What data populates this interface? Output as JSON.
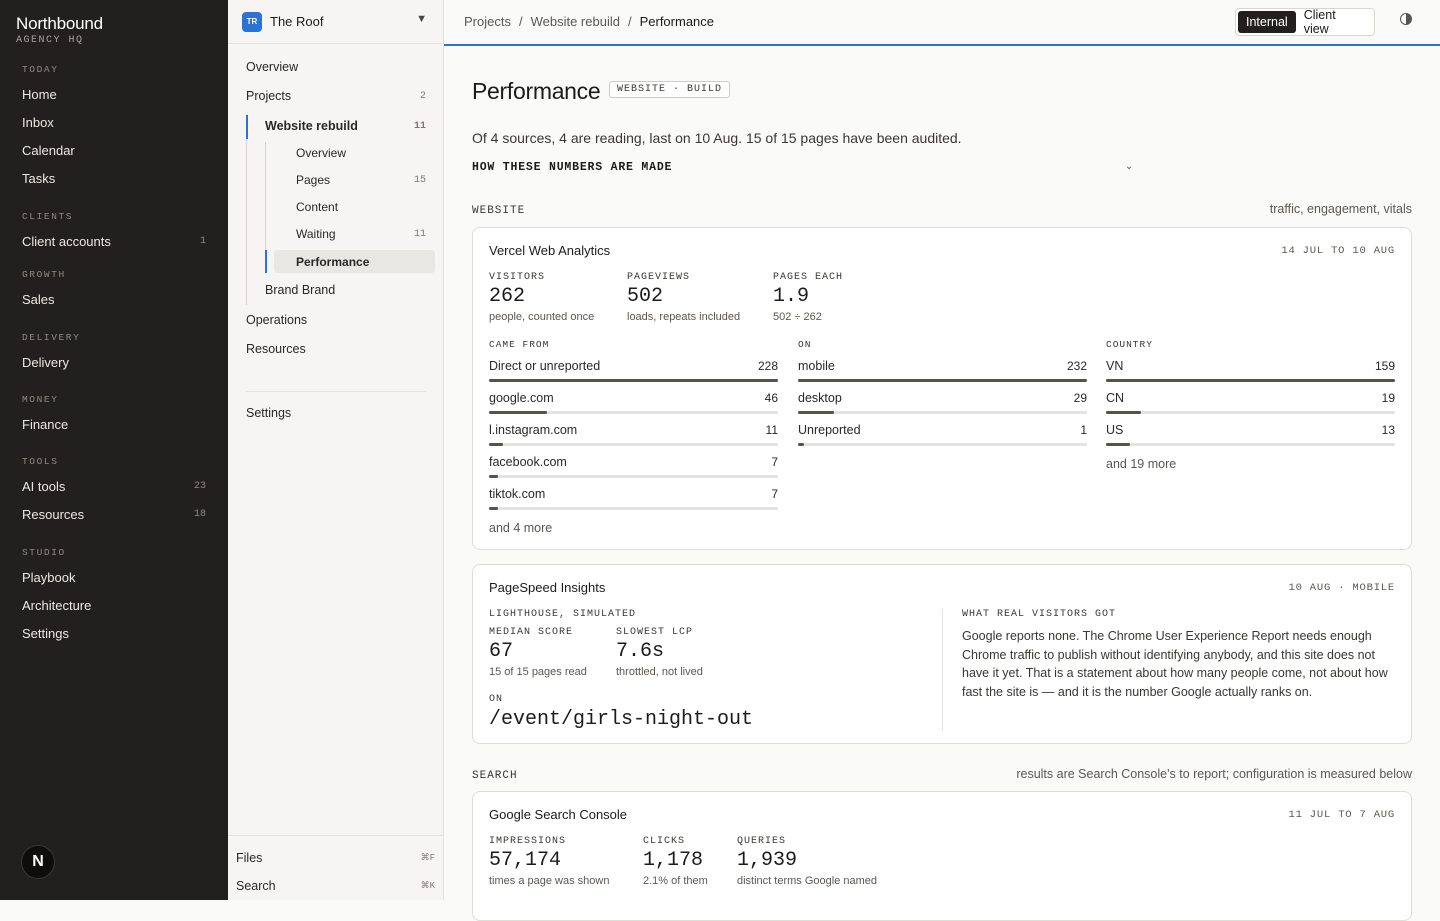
{
  "sidebar": {
    "brand": "Northbound",
    "brand_sub": "AGENCY HQ",
    "sections": [
      {
        "label": "TODAY"
      },
      {
        "label": "CLIENTS"
      },
      {
        "label": "GROWTH"
      },
      {
        "label": "DELIVERY"
      },
      {
        "label": "MONEY"
      },
      {
        "label": "TOOLS"
      },
      {
        "label": "STUDIO"
      }
    ],
    "items": [
      {
        "label": "Home"
      },
      {
        "label": "Inbox"
      },
      {
        "label": "Calendar"
      },
      {
        "label": "Tasks"
      },
      {
        "label": "Client accounts",
        "count": "1"
      },
      {
        "label": "Sales"
      },
      {
        "label": "Delivery"
      },
      {
        "label": "Finance"
      },
      {
        "label": "AI tools",
        "count": "23"
      },
      {
        "label": "Resources",
        "count": "18"
      },
      {
        "label": "Playbook"
      },
      {
        "label": "Architecture"
      },
      {
        "label": "Settings"
      }
    ],
    "user_initial": "N"
  },
  "project_nav": {
    "workspace": {
      "initials": "TR",
      "name": "The Roof",
      "caret": "▼"
    },
    "items": [
      {
        "label": "Overview"
      },
      {
        "label": "Projects",
        "count": "2"
      },
      {
        "label": "Website rebuild",
        "count": "11"
      },
      {
        "label": "Overview"
      },
      {
        "label": "Pages",
        "count": "15"
      },
      {
        "label": "Content"
      },
      {
        "label": "Waiting",
        "count": "11"
      },
      {
        "label": "Performance"
      },
      {
        "label": "Brand Brand"
      },
      {
        "label": "Operations"
      },
      {
        "label": "Resources"
      },
      {
        "label": "Settings"
      }
    ],
    "footer": [
      {
        "label": "Files",
        "shortcut": "⌘F"
      },
      {
        "label": "Search",
        "shortcut": "⌘K"
      }
    ]
  },
  "topbar": {
    "breadcrumbs": [
      "Projects",
      "Website rebuild",
      "Performance"
    ],
    "separator": "/",
    "view_options": [
      "Internal",
      "Client view"
    ],
    "selected_view": "Internal"
  },
  "page": {
    "title": "Performance",
    "tag": "WEBSITE · BUILD",
    "summary": "Of 4 sources, 4 are reading, last on 10 Aug. 15 of 15 pages have been audited.",
    "how_label": "HOW THESE NUMBERS ARE MADE",
    "how_chevron": "⌄"
  },
  "website_section": {
    "label": "WEBSITE",
    "note": "traffic, engagement, vitals"
  },
  "vercel": {
    "title": "Vercel Web Analytics",
    "date_range": "14 JUL TO 10 AUG",
    "stats": [
      {
        "label": "VISITORS",
        "value": "262",
        "note": "people, counted once"
      },
      {
        "label": "PAGEVIEWS",
        "value": "502",
        "note": "loads, repeats included"
      },
      {
        "label": "PAGES EACH",
        "value": "1.9",
        "note": "502 ÷ 262"
      }
    ],
    "breakdowns": [
      {
        "label": "CAME FROM",
        "max": 228,
        "rows": [
          {
            "name": "Direct or unreported",
            "value": 228
          },
          {
            "name": "google.com",
            "value": 46
          },
          {
            "name": "l.instagram.com",
            "value": 11
          },
          {
            "name": "facebook.com",
            "value": 7
          },
          {
            "name": "tiktok.com",
            "value": 7
          }
        ],
        "more": "and 4 more"
      },
      {
        "label": "ON",
        "max": 232,
        "rows": [
          {
            "name": "mobile",
            "value": 232
          },
          {
            "name": "desktop",
            "value": 29
          },
          {
            "name": "Unreported",
            "value": 1
          }
        ],
        "more": ""
      },
      {
        "label": "COUNTRY",
        "max": 159,
        "rows": [
          {
            "name": "VN",
            "value": 159
          },
          {
            "name": "CN",
            "value": 19
          },
          {
            "name": "US",
            "value": 13
          }
        ],
        "more": "and 19 more"
      }
    ]
  },
  "pagespeed": {
    "title": "PageSpeed Insights",
    "date": "10 AUG · MOBILE",
    "lighthouse_label": "LIGHTHOUSE, SIMULATED",
    "stats": [
      {
        "label": "MEDIAN SCORE",
        "value": "67",
        "note": "15 of 15 pages read"
      },
      {
        "label": "SLOWEST LCP",
        "value": "7.6s",
        "note": "throttled, not lived"
      }
    ],
    "on_label": "ON",
    "path": "/event/girls-night-out",
    "real_label": "WHAT REAL VISITORS GOT",
    "real_text": "Google reports none. The Chrome User Experience Report needs enough Chrome traffic to publish without identifying anybody, and this site does not have it yet. That is a statement about how many people come, not about how fast the site is — and it is the number Google actually ranks on."
  },
  "search_section": {
    "label": "SEARCH",
    "note": "results are Search Console's to report; configuration is measured below"
  },
  "gsc": {
    "title": "Google Search Console",
    "date_range": "11 JUL TO 7 AUG",
    "stats": [
      {
        "label": "IMPRESSIONS",
        "value": "57,174",
        "note": "times a page was shown"
      },
      {
        "label": "CLICKS",
        "value": "1,178",
        "note": "2.1% of them"
      },
      {
        "label": "QUERIES",
        "value": "1,939",
        "note": "distinct terms Google named"
      }
    ]
  },
  "colors": {
    "accent": "#2b72d6",
    "sidebar_bg": "#22201e",
    "bar_fill": "#55514b"
  }
}
